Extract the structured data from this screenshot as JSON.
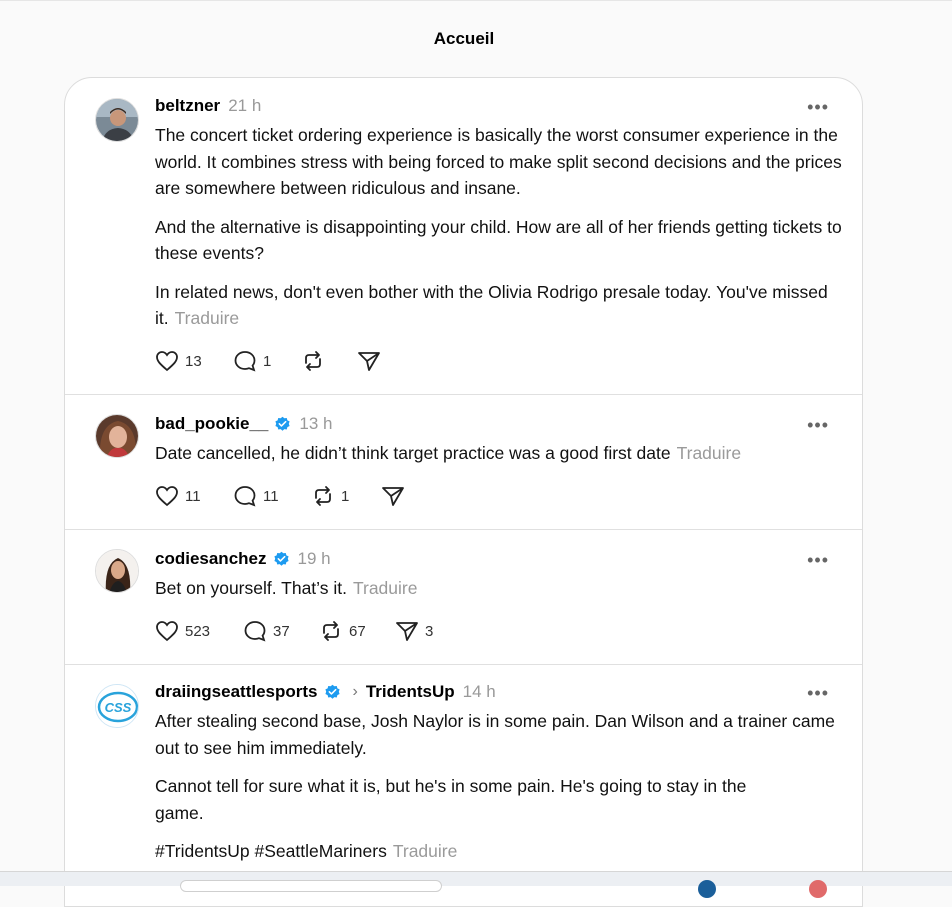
{
  "header": {
    "title": "Accueil"
  },
  "posts": [
    {
      "username": "beltzner",
      "time": "21 h",
      "verified": false,
      "paragraphs": [
        "The concert ticket ordering experience is basically the worst consumer experience in the world. It combines stress with being forced to make split second decisions and the prices are somewhere between ridiculous and insane.",
        "And the alternative is disappointing your child. How are all of her friends getting tickets to these events?",
        "In related news, don't even bother with the Olivia Rodrigo presale today. You've missed it."
      ],
      "translate": "Traduire",
      "likes": "13",
      "replies": "1",
      "reposts": "",
      "shares": ""
    },
    {
      "username": "bad_pookie__",
      "time": "13 h",
      "verified": true,
      "paragraphs": [
        "Date cancelled, he didn’t think target practice was a good first date"
      ],
      "translate": "Traduire",
      "likes": "11",
      "replies": "11",
      "reposts": "1",
      "shares": ""
    },
    {
      "username": "codiesanchez",
      "time": "19 h",
      "verified": true,
      "paragraphs": [
        "Bet on yourself. That’s it."
      ],
      "translate": "Traduire",
      "likes": "523",
      "replies": "37",
      "reposts": "67",
      "shares": "3"
    },
    {
      "username": "draiingseattlesports",
      "time": "14 h",
      "verified": true,
      "reply_to": "TridentsUp",
      "avatar_text": "CSS",
      "paragraphs": [
        "After stealing second base, Josh Naylor is in some pain. Dan Wilson and a trainer came out to see him immediately.",
        "Cannot tell for sure what it is, but he's in some pain. He's going to stay in the game.",
        "#TridentsUp #SeattleMariners"
      ],
      "translate": "Traduire"
    }
  ],
  "colors": {
    "verified": "#1d9bf0",
    "muted": "#999999"
  }
}
